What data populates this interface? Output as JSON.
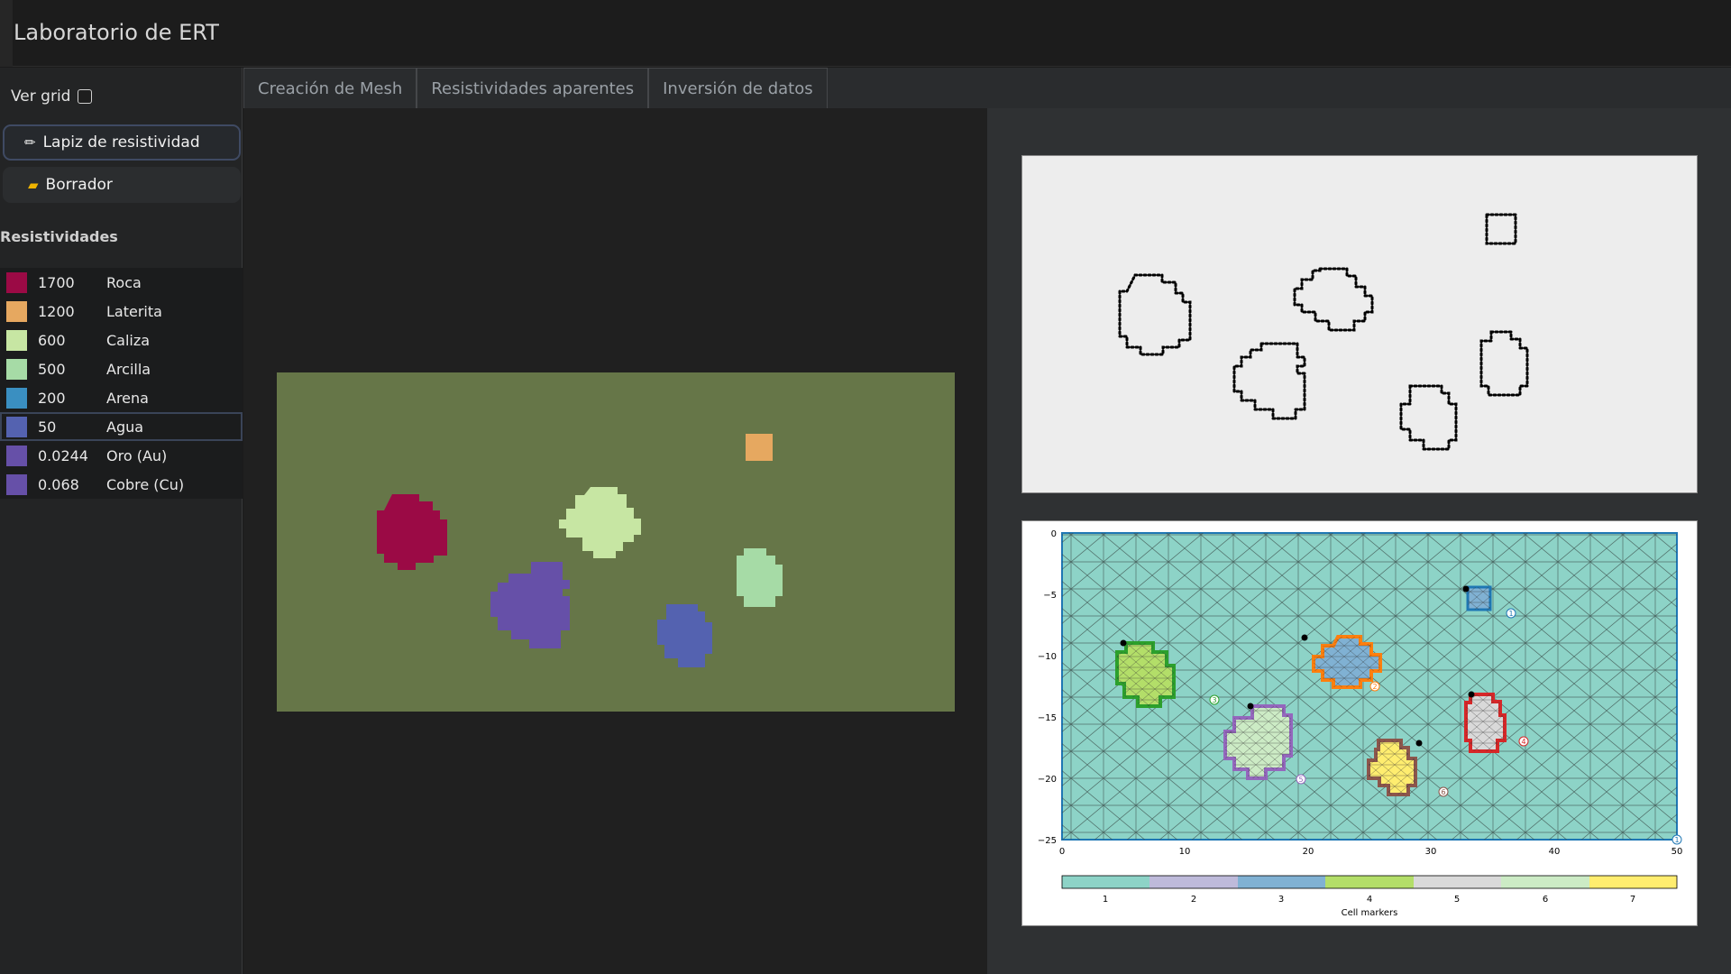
{
  "app": {
    "title": "Laboratorio de ERT"
  },
  "sidebar": {
    "grid_label": "Ver grid",
    "tools": [
      {
        "icon": "pencil-icon",
        "glyph": "✏",
        "label": "Lapiz de resistividad"
      },
      {
        "icon": "eraser-icon",
        "glyph": "▰",
        "label": "Borrador"
      }
    ],
    "section_title": "Resistividades",
    "resistivities": [
      {
        "value": "1700",
        "name": "Roca",
        "color": "#9b0a45"
      },
      {
        "value": "1200",
        "name": "Laterita",
        "color": "#e6a860"
      },
      {
        "value": "600",
        "name": "Caliza",
        "color": "#c7e6a3"
      },
      {
        "value": "500",
        "name": "Arcilla",
        "color": "#a6dba6"
      },
      {
        "value": "200",
        "name": "Arena",
        "color": "#3a8fc1"
      },
      {
        "value": "50",
        "name": "Agua",
        "color": "#5462b0"
      },
      {
        "value": "0.0244",
        "name": "Oro (Au)",
        "color": "#6650a8"
      },
      {
        "value": "0.068",
        "name": "Cobre (Cu)",
        "color": "#6650a8"
      }
    ],
    "selected_index": 5
  },
  "tabs": [
    {
      "label": "Creación de Mesh"
    },
    {
      "label": "Resistividades aparentes"
    },
    {
      "label": "Inversión de datos"
    }
  ],
  "mesh_plot": {
    "x_ticks": [
      "0",
      "10",
      "20",
      "30",
      "40",
      "50"
    ],
    "y_ticks": [
      "0",
      "−5",
      "−10",
      "−15",
      "−20",
      "−25"
    ],
    "colorbar_ticks": [
      "1",
      "2",
      "3",
      "4",
      "5",
      "6",
      "7"
    ],
    "colorbar_label": "Cell markers",
    "region_markers": [
      "1",
      "2",
      "3",
      "4",
      "5",
      "6",
      "1"
    ],
    "colors": [
      "#8dd3c7",
      "#bebada",
      "#80b1d3",
      "#b3de69",
      "#d9d9d9",
      "#ccebc5",
      "#ffed6f"
    ]
  }
}
